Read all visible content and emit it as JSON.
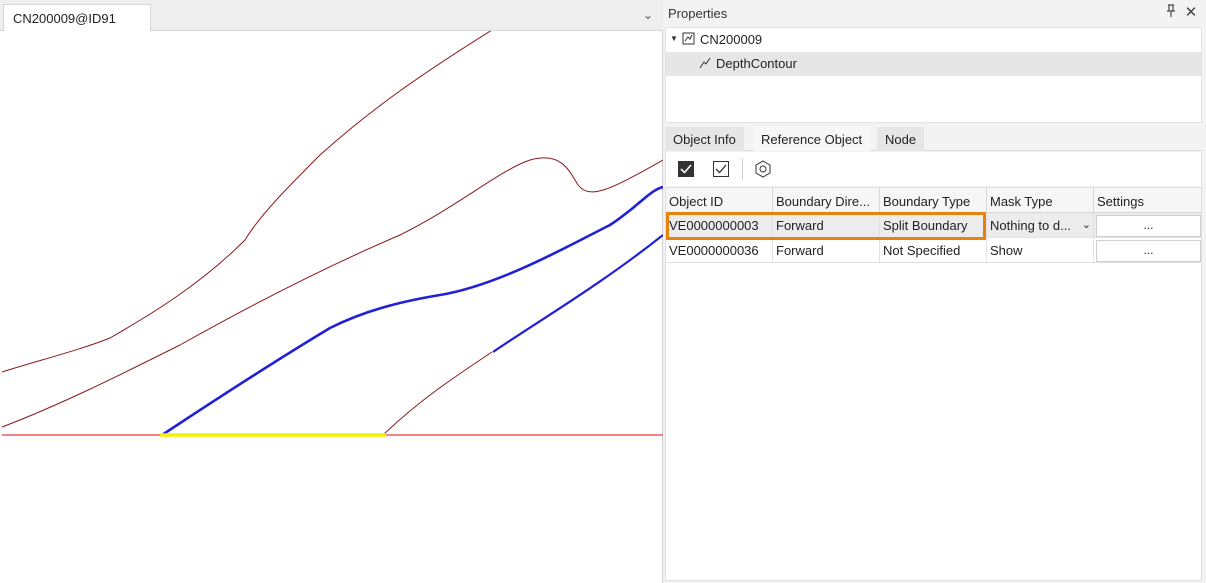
{
  "document": {
    "tab_label": "CN200009@ID91",
    "dropdown_icon": "chevron-down-icon"
  },
  "colors": {
    "contour_brown": "#8b1a1a",
    "contour_blue": "#2020d8",
    "baseline_red": "#e83a3a",
    "segment_yellow": "#f2f200",
    "selection_orange": "#e8820e"
  },
  "properties": {
    "title": "Properties",
    "pin_icon": "pin-icon",
    "close_icon": "close-icon",
    "tree": {
      "root_label": "CN200009",
      "child_label": "DepthContour"
    },
    "tabs": [
      "Object Info",
      "Reference Object",
      "Node"
    ],
    "active_tab": "Reference Object",
    "toolbar_icons": [
      "checkbox-filled-icon",
      "checkbox-outline-icon",
      "hexagon-nut-icon"
    ],
    "grid": {
      "columns": [
        "Object ID",
        "Boundary Dire...",
        "Boundary Type",
        "Mask Type",
        "Settings"
      ],
      "rows": [
        {
          "object_id": "VE0000000003",
          "direction": "Forward",
          "boundary_type": "Split Boundary",
          "mask_type": "Nothing to d...",
          "settings": "..."
        },
        {
          "object_id": "VE0000000036",
          "direction": "Forward",
          "boundary_type": "Not Specified",
          "mask_type": "Show",
          "settings": "..."
        }
      ]
    }
  }
}
